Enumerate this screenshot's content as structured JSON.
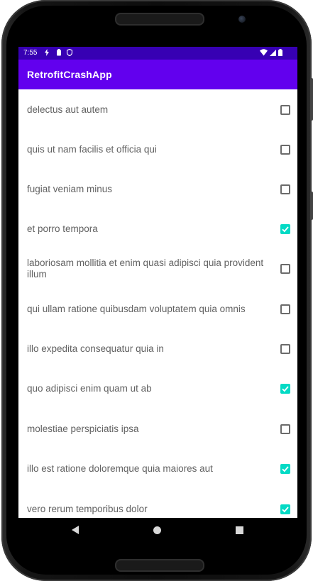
{
  "status": {
    "time": "7:55",
    "left_icons": [
      "lightning-icon",
      "clipboard-icon",
      "shield-icon"
    ],
    "right_icons": [
      "wifi-icon",
      "signal-icon",
      "battery-icon"
    ]
  },
  "appbar": {
    "title": "RetrofitCrashApp"
  },
  "colors": {
    "status_bar": "#3700b3",
    "app_bar": "#6200ee",
    "checkbox_checked": "#03dac5"
  },
  "items": [
    {
      "label": "delectus aut autem",
      "checked": false
    },
    {
      "label": "quis ut nam facilis et officia qui",
      "checked": false
    },
    {
      "label": "fugiat veniam minus",
      "checked": false
    },
    {
      "label": "et porro tempora",
      "checked": true
    },
    {
      "label": "laboriosam mollitia et enim quasi adipisci quia provident illum",
      "checked": false
    },
    {
      "label": "qui ullam ratione quibusdam voluptatem quia omnis",
      "checked": false
    },
    {
      "label": "illo expedita consequatur quia in",
      "checked": false
    },
    {
      "label": "quo adipisci enim quam ut ab",
      "checked": true
    },
    {
      "label": "molestiae perspiciatis ipsa",
      "checked": false
    },
    {
      "label": "illo est ratione doloremque quia maiores aut",
      "checked": true
    },
    {
      "label": "vero rerum temporibus dolor",
      "checked": true
    }
  ],
  "navbar": {
    "buttons": [
      "back-icon",
      "home-icon",
      "recents-icon"
    ]
  }
}
